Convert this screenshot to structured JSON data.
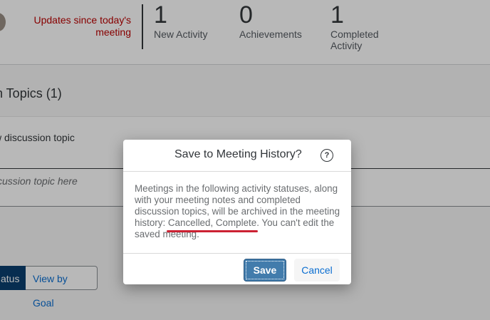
{
  "header": {
    "updates_label": "Updates since today's meeting",
    "stats": [
      {
        "value": "1",
        "label": "New Activity"
      },
      {
        "value": "0",
        "label": "Achievements"
      },
      {
        "value": "1",
        "label": "Completed Activity"
      }
    ]
  },
  "main": {
    "topics_heading": "n Topics (1)",
    "new_topic_label": "w discussion topic",
    "topic_placeholder": "cussion topic here",
    "view_buttons": {
      "active": "atus",
      "other": "View by Goal"
    }
  },
  "dialog": {
    "title": "Save to Meeting History?",
    "body_before": "Meetings in the following activity statuses, along with your meeting notes and completed discussion topics, will be archived in the meeting history: ",
    "body_highlight": "Cancelled, Complete",
    "body_after": ". You can't edit the saved meeting.",
    "save_label": "Save",
    "cancel_label": "Cancel",
    "help_icon": "help-icon",
    "help_glyph": "?"
  },
  "colors": {
    "accent_blue": "#0a6ed1",
    "save_button": "#427cac",
    "alert_red": "#bb0000",
    "highlight_underline": "#cc2233"
  }
}
